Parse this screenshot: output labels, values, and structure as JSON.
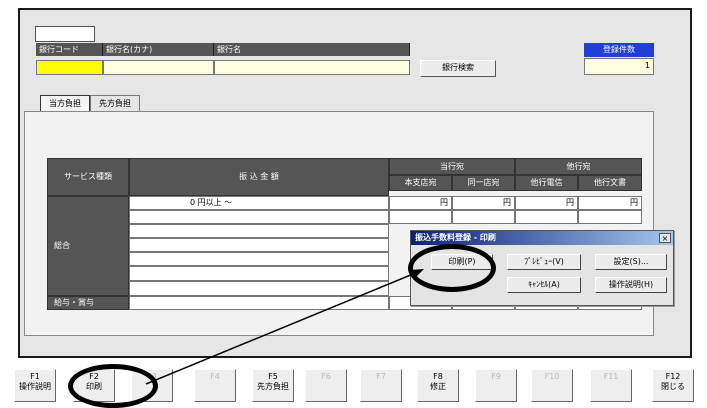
{
  "bank_fields": {
    "code_label": "銀行コード",
    "kana_label": "銀行名(カナ)",
    "name_label": "銀行名",
    "code_value": "",
    "kana_value": "",
    "name_value": ""
  },
  "search_button": "銀行検索",
  "registered": {
    "label": "登録件数",
    "value": "1"
  },
  "tabs": [
    "当方負担",
    "先方負担"
  ],
  "table": {
    "service_header": "サービス種類",
    "amount_header": "振 込 金 額",
    "own_bank_header": "当行宛",
    "other_bank_header": "他行宛",
    "sub_headers": [
      "本支店宛",
      "同一店宛",
      "他行電信",
      "他行文書"
    ],
    "first_row_amount": "0 円以上 〜",
    "yen": "円",
    "row_general": "総合",
    "row_salary": "給与・賞与"
  },
  "dialog": {
    "title": "振込手数料登録 - 印刷",
    "close": "×",
    "buttons": [
      "印刷(P)",
      "ﾌﾟﾚﾋﾞｭｰ(V)",
      "設定(S)...",
      "ｷｬﾝｾﾙ(A)",
      "操作説明(H)"
    ]
  },
  "fkeys": [
    {
      "key": "F1",
      "label": "操作説明"
    },
    {
      "key": "F2",
      "label": "印刷"
    },
    {
      "key": "F3",
      "label": ""
    },
    {
      "key": "F4",
      "label": ""
    },
    {
      "key": "F5",
      "label": "先方負担"
    },
    {
      "key": "F6",
      "label": ""
    },
    {
      "key": "F7",
      "label": ""
    },
    {
      "key": "F8",
      "label": "修正"
    },
    {
      "key": "F9",
      "label": ""
    },
    {
      "key": "F10",
      "label": ""
    },
    {
      "key": "F11",
      "label": ""
    },
    {
      "key": "F12",
      "label": "閉じる"
    }
  ],
  "colors": {
    "highlight_yellow": "#ffff00",
    "header_gray": "#555555",
    "title_blue": "#0a1e78",
    "registered_blue": "#1f3fd6"
  }
}
